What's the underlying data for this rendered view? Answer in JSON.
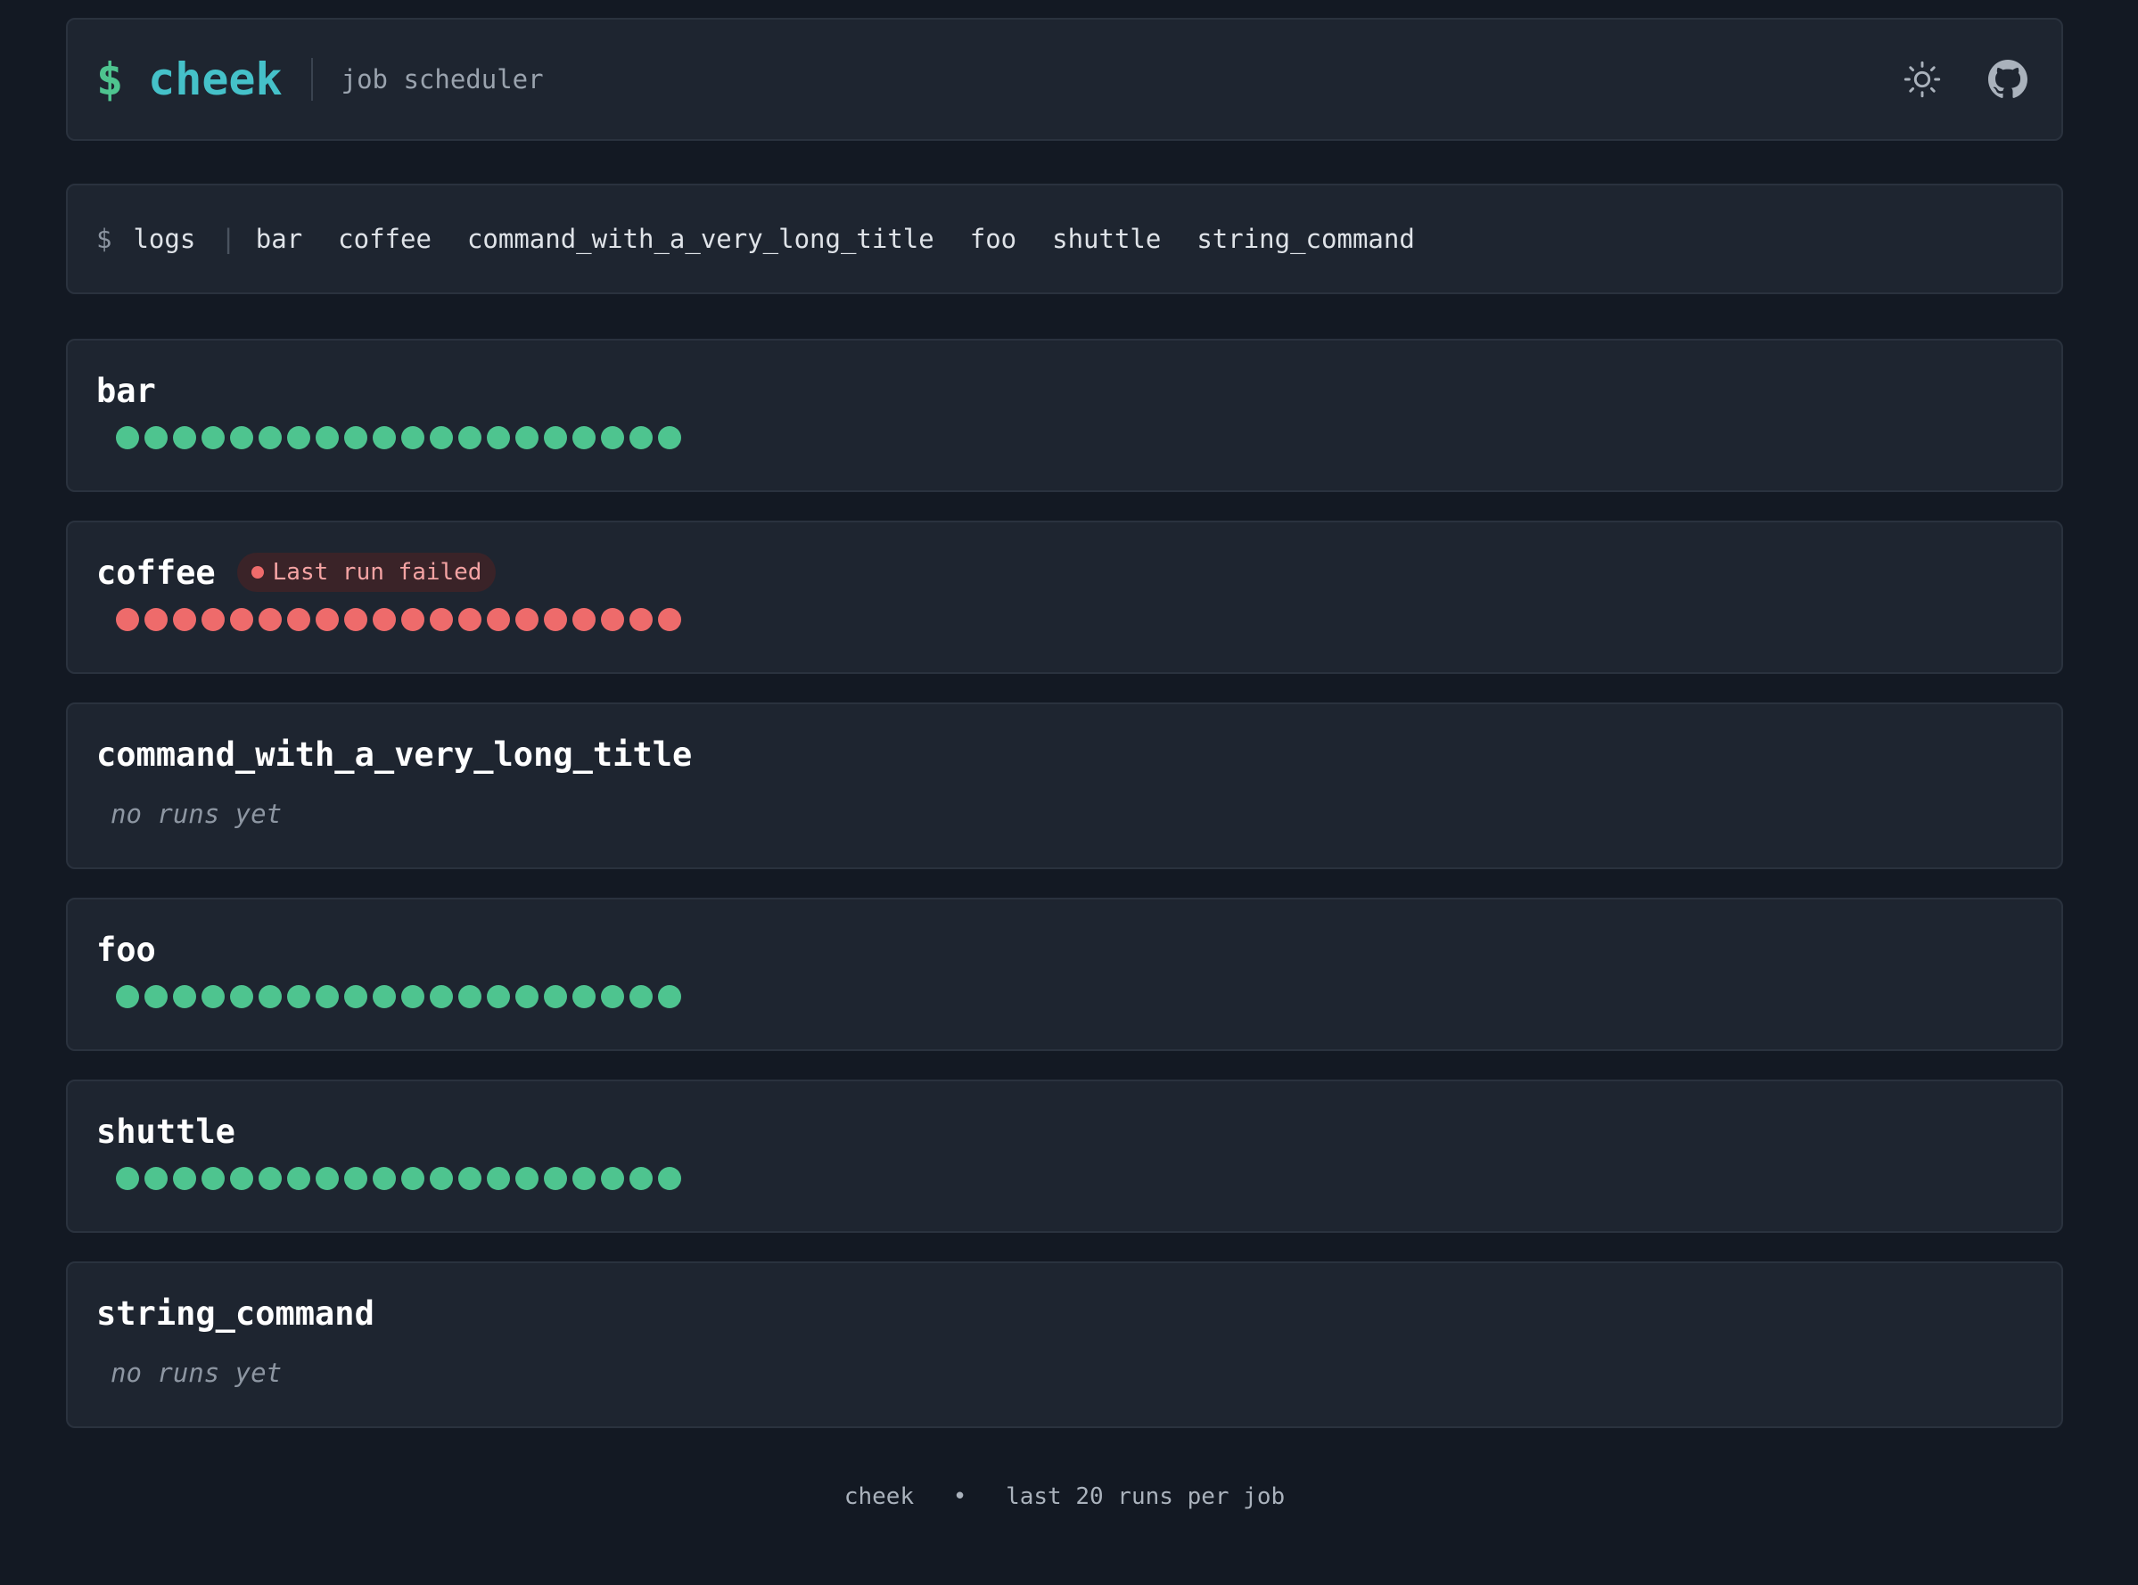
{
  "header": {
    "prompt": "$",
    "app_name": "cheek",
    "tagline": "job scheduler",
    "theme_icon": "sun-icon",
    "repo_icon": "github-icon"
  },
  "nav": {
    "prompt": "$",
    "logs_label": "logs",
    "separator": "|",
    "links": [
      "bar",
      "coffee",
      "command_with_a_very_long_title",
      "foo",
      "shuttle",
      "string_command"
    ]
  },
  "jobs": [
    {
      "name": "bar",
      "status": "success",
      "runs": 20
    },
    {
      "name": "coffee",
      "status": "failed",
      "badge": "Last run failed",
      "runs": 20
    },
    {
      "name": "command_with_a_very_long_title",
      "status": "none",
      "empty_text": "no runs yet",
      "runs": 0
    },
    {
      "name": "foo",
      "status": "success",
      "runs": 20
    },
    {
      "name": "shuttle",
      "status": "success",
      "runs": 20
    },
    {
      "name": "string_command",
      "status": "none",
      "empty_text": "no runs yet",
      "runs": 0
    }
  ],
  "colors": {
    "success": "#4ec48f",
    "failed": "#ee6b6b",
    "accent": "#45c1c9"
  },
  "footer": {
    "app": "cheek",
    "bullet": "•",
    "note": "last 20 runs per job"
  }
}
